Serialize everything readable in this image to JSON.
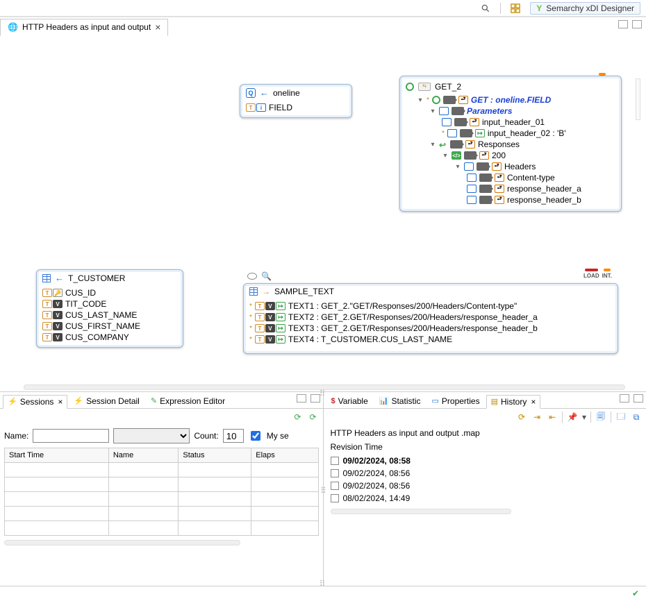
{
  "app_title": "Semarchy xDI Designer",
  "editor_tab": "HTTP Headers as input and output",
  "oneline": {
    "title": "oneline",
    "fields": [
      "FIELD"
    ]
  },
  "t_customer": {
    "title": "T_CUSTOMER",
    "fields": [
      "CUS_ID",
      "TIT_CODE",
      "CUS_LAST_NAME",
      "CUS_FIRST_NAME",
      "CUS_COMPANY"
    ]
  },
  "get2": {
    "title": "GET_2",
    "root": "GET : oneline.FIELD",
    "parameters_label": "Parameters",
    "params": [
      "input_header_01",
      "input_header_02 : 'B'"
    ],
    "responses_label": "Responses",
    "code": "200",
    "headers_label": "Headers",
    "headers": [
      "Content-type",
      "response_header_a",
      "response_header_b"
    ]
  },
  "badges": {
    "int": "INT.",
    "load": "LOAD"
  },
  "sample": {
    "title": "SAMPLE_TEXT",
    "rows": [
      "TEXT1 : GET_2.\"GET/Responses/200/Headers/Content-type\"",
      "TEXT2 : GET_2.GET/Responses/200/Headers/response_header_a",
      "TEXT3 : GET_2.GET/Responses/200/Headers/response_header_b",
      "TEXT4 : T_CUSTOMER.CUS_LAST_NAME"
    ]
  },
  "bottom_left": {
    "tabs": [
      "Sessions",
      "Session Detail",
      "Expression Editor"
    ],
    "name_label": "Name:",
    "name_value": "",
    "dropdown_value": "",
    "count_label": "Count:",
    "count_value": "10",
    "chk_label": "My se",
    "columns": [
      "Start Time",
      "Name",
      "Status",
      "Elaps"
    ]
  },
  "bottom_right": {
    "tabs": [
      "Variable",
      "Statistic",
      "Properties",
      "History"
    ],
    "file": "HTTP Headers as input and output .map",
    "revision_label": "Revision Time",
    "history": [
      "09/02/2024, 08:58",
      "09/02/2024, 08:56",
      "09/02/2024, 08:56",
      "08/02/2024, 14:49"
    ]
  }
}
